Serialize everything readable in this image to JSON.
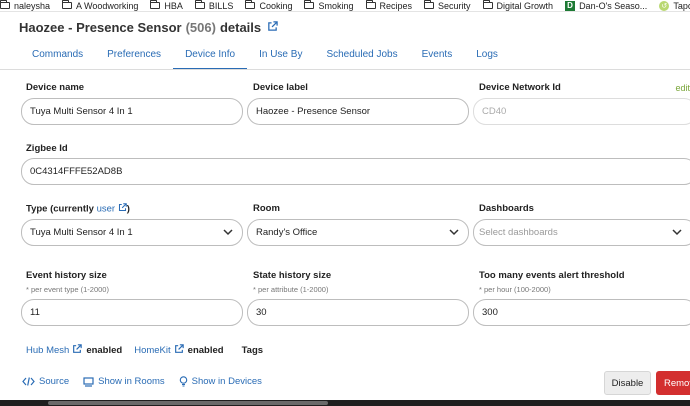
{
  "bookmarks": [
    {
      "label": "naleysha",
      "icon": "folder-icon"
    },
    {
      "label": "A Woodworking",
      "icon": "folder-icon"
    },
    {
      "label": "HBA",
      "icon": "folder-icon"
    },
    {
      "label": "BILLS",
      "icon": "folder-icon"
    },
    {
      "label": "Cooking",
      "icon": "folder-icon"
    },
    {
      "label": "Smoking",
      "icon": "folder-icon"
    },
    {
      "label": "Recipes",
      "icon": "folder-icon"
    },
    {
      "label": "Security",
      "icon": "folder-icon"
    },
    {
      "label": "Digital Growth",
      "icon": "folder-icon"
    },
    {
      "label": "Dan-O's Seaso...",
      "icon": "dano-favicon"
    },
    {
      "label": "Tapco Matter D...",
      "icon": "tapco-favicon"
    }
  ],
  "header": {
    "title": "Haozee - Presence Sensor",
    "device_id": "(506)",
    "title_suffix": "details"
  },
  "tabs": [
    "Commands",
    "Preferences",
    "Device Info",
    "In Use By",
    "Scheduled Jobs",
    "Events",
    "Logs"
  ],
  "active_tab": "Device Info",
  "edit_link": "edit",
  "fields": {
    "device_name": {
      "label": "Device name",
      "value": "Tuya Multi Sensor 4 In 1"
    },
    "device_label": {
      "label": "Device label",
      "value": "Haozee - Presence Sensor"
    },
    "network_id": {
      "label": "Device Network Id",
      "value": "CD40"
    },
    "zigbee_id": {
      "label": "Zigbee Id",
      "value": "0C4314FFFE52AD8B"
    },
    "type": {
      "label_prefix": "Type (currently",
      "label_link": "user",
      "label_suffix": ")",
      "value": "Tuya Multi Sensor 4 In 1"
    },
    "room": {
      "label": "Room",
      "value": "Randy's Office"
    },
    "dashboards": {
      "label": "Dashboards",
      "placeholder": "Select dashboards"
    },
    "event_history": {
      "label": "Event history size",
      "hint": "* per event type (1-2000)",
      "value": "11"
    },
    "state_history": {
      "label": "State history size",
      "hint": "* per attribute (1-2000)",
      "value": "30"
    },
    "alert_threshold": {
      "label": "Too many events alert threshold",
      "hint": "* per hour (100-2000)",
      "value": "300"
    }
  },
  "integrations": {
    "hub_mesh": {
      "name": "Hub Mesh",
      "state": "enabled"
    },
    "homekit": {
      "name": "HomeKit",
      "state": "enabled"
    },
    "tags_label": "Tags"
  },
  "actions": {
    "source": "Source",
    "show_in_rooms": "Show in Rooms",
    "show_in_devices": "Show in Devices",
    "disable": "Disable",
    "remove": "Remove"
  },
  "colors": {
    "link": "#2a6cb5",
    "edit": "#7aa63a",
    "remove_button": "#d32f2f"
  }
}
